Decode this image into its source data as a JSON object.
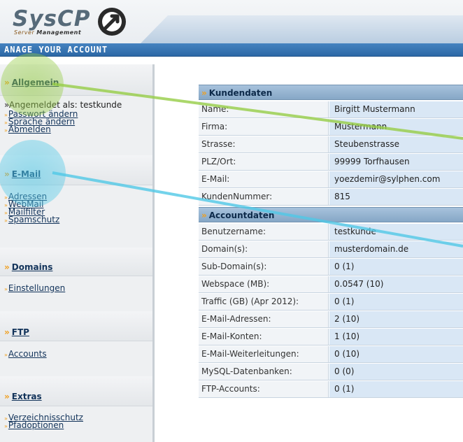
{
  "header": {
    "logo_main": "SysCP",
    "logo_sub_prefix": "Server",
    "logo_sub_suffix": "Management",
    "subtitle": "ANAGE YOUR ACCOUNT"
  },
  "sidebar": {
    "sections": [
      {
        "title": "Allgemein",
        "logged_in_text": "Angemeldet als: testkunde",
        "links": [
          "Passwort ändern",
          "Sprache ändern",
          "Abmelden"
        ]
      },
      {
        "title": "E-Mail",
        "links": [
          "Adressen",
          "WebMail",
          "Mailfilter",
          "Spamschutz"
        ]
      },
      {
        "title": "Domains",
        "links": [
          "Einstellungen"
        ]
      },
      {
        "title": "FTP",
        "links": [
          "Accounts"
        ]
      },
      {
        "title": "Extras",
        "links": [
          "Verzeichnisschutz",
          "Pfadoptionen"
        ]
      }
    ]
  },
  "kundendaten": {
    "title": "Kundendaten",
    "rows": [
      {
        "label": "Name:",
        "value": "Birgitt Mustermann"
      },
      {
        "label": "Firma:",
        "value": "Mustermann"
      },
      {
        "label": "Strasse:",
        "value": "Steubenstrasse"
      },
      {
        "label": "PLZ/Ort:",
        "value": "99999 Torfhausen"
      },
      {
        "label": "E-Mail:",
        "value": "yoezdemir@sylphen.com"
      },
      {
        "label": "KundenNummer:",
        "value": "815"
      }
    ]
  },
  "accountdaten": {
    "title": "Accountdaten",
    "rows": [
      {
        "label": "Benutzername:",
        "value": "testkunde"
      },
      {
        "label": "Domain(s):",
        "value": "musterdomain.de"
      },
      {
        "label": "Sub-Domain(s):",
        "value": "0 (1)"
      },
      {
        "label": "Webspace (MB):",
        "value": "0.0547 (10)"
      },
      {
        "label": "Traffic (GB) (Apr 2012):",
        "value": "0 (1)"
      },
      {
        "label": "E-Mail-Adressen:",
        "value": "2 (10)"
      },
      {
        "label": "E-Mail-Konten:",
        "value": "1 (10)"
      },
      {
        "label": "E-Mail-Weiterleitungen:",
        "value": "0 (10)"
      },
      {
        "label": "MySQL-Datenbanken:",
        "value": "0 (0)"
      },
      {
        "label": "FTP-Accounts:",
        "value": "0 (1)"
      }
    ]
  },
  "colors": {
    "accent_orange": "#f0a020",
    "link_blue": "#12335a",
    "header_blue": "#2c68a6",
    "highlight_green": "#9fd44a",
    "highlight_cyan": "#5bc9e6"
  }
}
